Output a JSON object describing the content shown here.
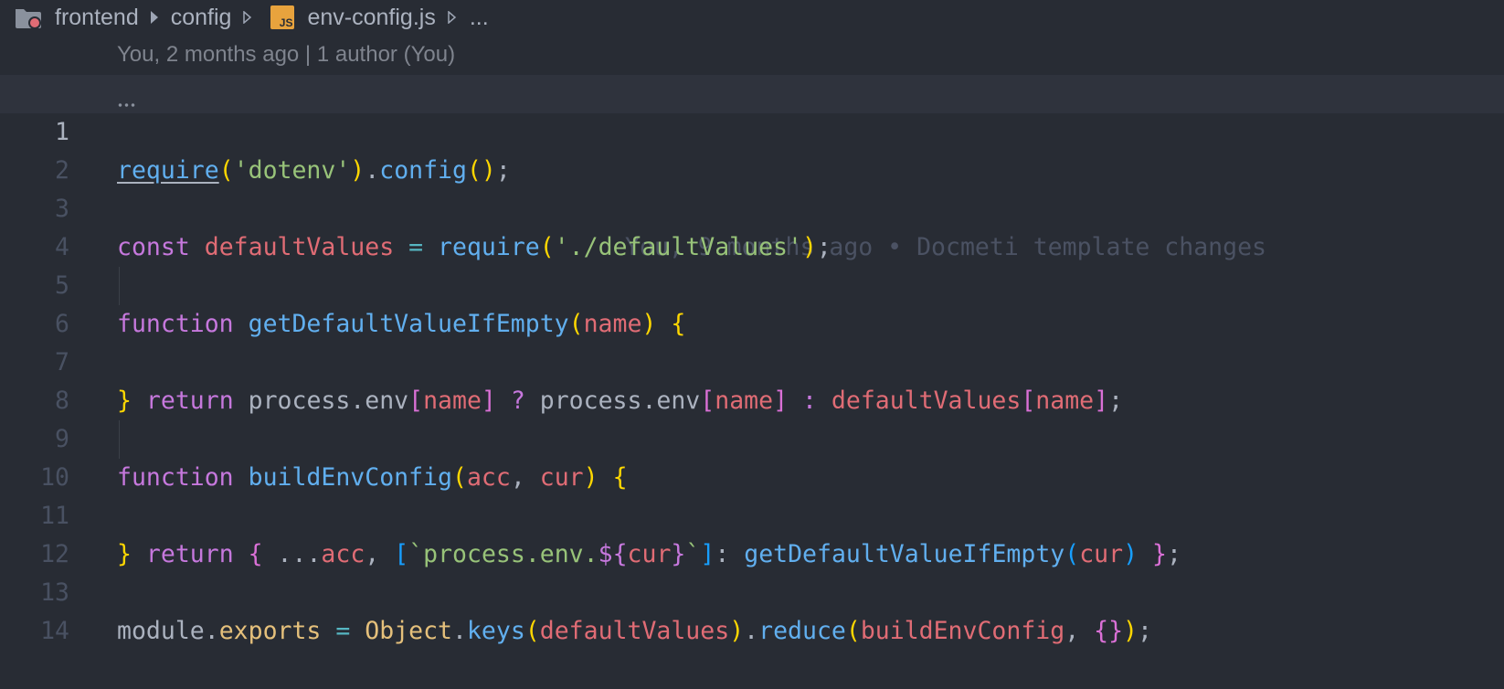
{
  "breadcrumb": {
    "folder_icon": "folder-icon",
    "items": [
      "frontend",
      "config",
      "env-config.js",
      "..."
    ],
    "file_icon_label": "JS",
    "accent_color": "#e8a33d"
  },
  "blame_header": "You, 2 months ago | 1 author (You)",
  "inline_blame": "You, 9 months ago • Docmeti template changes",
  "line_numbers": [
    "1",
    "2",
    "3",
    "4",
    "5",
    "6",
    "7",
    "8",
    "9",
    "10",
    "11",
    "12",
    "13",
    "14"
  ],
  "code": {
    "l1": {
      "require": "require",
      "p1": "(",
      "dotenv": "'dotenv'",
      "p2": ")",
      "dot": ".",
      "config": "config",
      "p3": "()",
      "semi": ";"
    },
    "l3": {
      "const": "const",
      "sp1": " ",
      "name": "defaultValues",
      "eq": " = ",
      "require": "require",
      "p1": "(",
      "path": "'./defaultValues'",
      "p2": ")",
      "semi": ";"
    },
    "l5": {
      "function": "function",
      "sp": " ",
      "name": "getDefaultValueIfEmpty",
      "p1": "(",
      "arg": "name",
      "p2": ")",
      "sp2": " ",
      "brace": "{"
    },
    "l6": {
      "indent": "  ",
      "return": "return",
      "sp": " ",
      "process1": "process.env",
      "b1": "[",
      "name1": "name",
      "b2": "]",
      "q": " ? ",
      "process2": "process.env",
      "b3": "[",
      "name2": "name",
      "b4": "]",
      "colon": " : ",
      "dv": "defaultValues",
      "b5": "[",
      "name3": "name",
      "b6": "]",
      "semi": ";"
    },
    "l7": {
      "brace": "}"
    },
    "l9": {
      "function": "function",
      "sp": " ",
      "name": "buildEnvConfig",
      "p1": "(",
      "acc": "acc",
      "comma": ", ",
      "cur": "cur",
      "p2": ")",
      "sp2": " ",
      "brace": "{"
    },
    "l10": {
      "indent": "  ",
      "return": "return",
      "sp": " ",
      "ob": "{",
      "spread": " ...",
      "acc": "acc",
      "comma": ", ",
      "sb1": "[",
      "tpl1": "`process.env.",
      "dollar": "${",
      "cur1": "cur",
      "cb": "}",
      "tpl2": "`",
      "sb2": "]",
      "colon": ": ",
      "fn": "getDefaultValueIfEmpty",
      "p1": "(",
      "cur2": "cur",
      "p2": ")",
      "sp2": " ",
      "cb2": "}",
      "semi": ";"
    },
    "l11": {
      "brace": "}"
    },
    "l13": {
      "module": "module",
      "dot1": ".",
      "exports": "exports",
      "eq": " = ",
      "obj": "Object",
      "dot2": ".",
      "keys": "keys",
      "p1": "(",
      "dv": "defaultValues",
      "p2": ")",
      "dot3": ".",
      "reduce": "reduce",
      "p3": "(",
      "bec": "buildEnvConfig",
      "comma": ", ",
      "empty": "{}",
      "p4": ")",
      "semi": ";"
    }
  }
}
